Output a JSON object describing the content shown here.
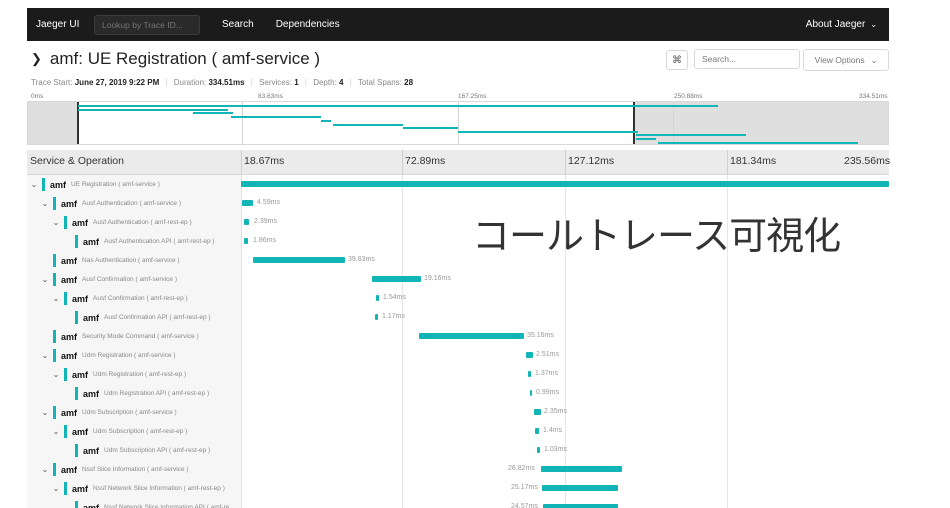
{
  "nav": {
    "brand": "Jaeger UI",
    "lookup_placeholder": "Lookup by Trace ID...",
    "search": "Search",
    "dependencies": "Dependencies",
    "about": "About Jaeger"
  },
  "trace": {
    "title": "amf: UE Registration ( amf-service )",
    "trace_start_label": "Trace Start:",
    "trace_start": "June 27, 2019 9:22 PM",
    "duration_label": "Duration:",
    "duration": "334.51ms",
    "services_label": "Services:",
    "services": "1",
    "depth_label": "Depth:",
    "depth": "4",
    "total_spans_label": "Total Spans:",
    "total_spans": "28"
  },
  "header_tools": {
    "kbd_icon": "⌘",
    "search_placeholder": "Search...",
    "view_options": "View Options"
  },
  "minimap_ticks": [
    "0ms",
    "83.63ms",
    "167.25ms",
    "250.88ms",
    "334.51ms"
  ],
  "timeline": {
    "column_title": "Service & Operation",
    "ticks": [
      "18.67ms",
      "72.89ms",
      "127.12ms",
      "181.34ms",
      "235.56ms"
    ]
  },
  "spans": [
    {
      "service": "amf",
      "operation": "UE Registration ( amf-service )",
      "depth": 0,
      "expandable": true,
      "label": ""
    },
    {
      "service": "amf",
      "operation": "Ausf Authentication ( amf-service )",
      "depth": 1,
      "expandable": true,
      "label": "4.59ms"
    },
    {
      "service": "amf",
      "operation": "Ausf Authentication ( amf-rest-ep )",
      "depth": 2,
      "expandable": true,
      "label": "2.39ms"
    },
    {
      "service": "amf",
      "operation": "Ausf Authentication API ( amf-rest-ep )",
      "depth": 3,
      "expandable": false,
      "label": "1.86ms"
    },
    {
      "service": "amf",
      "operation": "Nas Authentication ( amf-service )",
      "depth": 1,
      "expandable": false,
      "label": "39.83ms"
    },
    {
      "service": "amf",
      "operation": "Ausf Confirmation ( amf-service )",
      "depth": 1,
      "expandable": true,
      "label": "19.16ms"
    },
    {
      "service": "amf",
      "operation": "Ausf Confirmation ( amf-rest-ep )",
      "depth": 2,
      "expandable": true,
      "label": "1.54ms"
    },
    {
      "service": "amf",
      "operation": "Ausf Confirmation API ( amf-rest-ep )",
      "depth": 3,
      "expandable": false,
      "label": "1.17ms"
    },
    {
      "service": "amf",
      "operation": "Security Mode Command ( amf-service )",
      "depth": 1,
      "expandable": false,
      "label": "35.16ms"
    },
    {
      "service": "amf",
      "operation": "Udm Registration ( amf-service )",
      "depth": 1,
      "expandable": true,
      "label": "2.51ms"
    },
    {
      "service": "amf",
      "operation": "Udm Registration ( amf-rest-ep )",
      "depth": 2,
      "expandable": true,
      "label": "1.37ms"
    },
    {
      "service": "amf",
      "operation": "Udm Registration API ( amf-rest-ep )",
      "depth": 3,
      "expandable": false,
      "label": "0.99ms"
    },
    {
      "service": "amf",
      "operation": "Udm Subscription ( amf-service )",
      "depth": 1,
      "expandable": true,
      "label": "2.35ms"
    },
    {
      "service": "amf",
      "operation": "Udm Subscription ( amf-rest-ep )",
      "depth": 2,
      "expandable": true,
      "label": "1.4ms"
    },
    {
      "service": "amf",
      "operation": "Udm Subscription API ( amf-rest-ep )",
      "depth": 3,
      "expandable": false,
      "label": "1.03ms"
    },
    {
      "service": "amf",
      "operation": "Nssf Slice Information ( amf-service )",
      "depth": 1,
      "expandable": true,
      "label": "26.82ms"
    },
    {
      "service": "amf",
      "operation": "Nssf Network Slice Information ( amf-rest-ep )",
      "depth": 2,
      "expandable": true,
      "label": "25.17ms"
    },
    {
      "service": "amf",
      "operation": "Nssf Network Slice Information API ( amf-re...",
      "depth": 3,
      "expandable": false,
      "label": "24.57ms"
    }
  ],
  "overlay": {
    "text": "コールトレース可視化"
  },
  "colors": {
    "accent": "#12b5b5",
    "nav_bg": "#1b1b1b"
  }
}
